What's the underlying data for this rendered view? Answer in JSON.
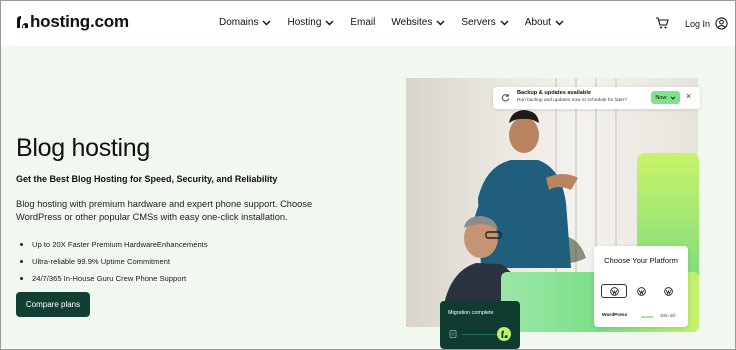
{
  "header": {
    "logo_text": "hosting.com",
    "nav": [
      {
        "label": "Domains",
        "has_dropdown": true
      },
      {
        "label": "Hosting",
        "has_dropdown": true
      },
      {
        "label": "Email",
        "has_dropdown": false
      },
      {
        "label": "Websites",
        "has_dropdown": true
      },
      {
        "label": "Servers",
        "has_dropdown": true
      },
      {
        "label": "About",
        "has_dropdown": true
      }
    ],
    "cart_icon": "cart-icon",
    "login_label": "Log In",
    "user_icon": "user-circle-icon"
  },
  "hero": {
    "title": "Blog hosting",
    "subtitle": "Get the Best Blog Hosting for Speed, Security, and Reliability",
    "description": "Blog hosting with premium hardware and expert phone support. Choose WordPress or other popular CMSs with easy one-click installation.",
    "bullets": [
      "Up to 20X Faster Premium HardwareEnhancements",
      "Ultra-reliable 99.9% Uptime Commitment",
      "24/7/365 In-House Guru Crew Phone Support"
    ],
    "cta_label": "Compare plans"
  },
  "notification": {
    "title": "Backup & updates available",
    "text": "Run backup and updates now or schedule for later?",
    "badge": "Now",
    "close": "×"
  },
  "platform_card": {
    "title": "Choose Your Platform",
    "option_label": "WordPress",
    "time_left": "30m left",
    "progress": 0.35
  },
  "migration_card": {
    "title": "Migration complete"
  },
  "colors": {
    "background": "#f0f8ef",
    "cta": "#123f33",
    "accent_green": "#7ee38c",
    "dark_green": "#0f3b30"
  }
}
